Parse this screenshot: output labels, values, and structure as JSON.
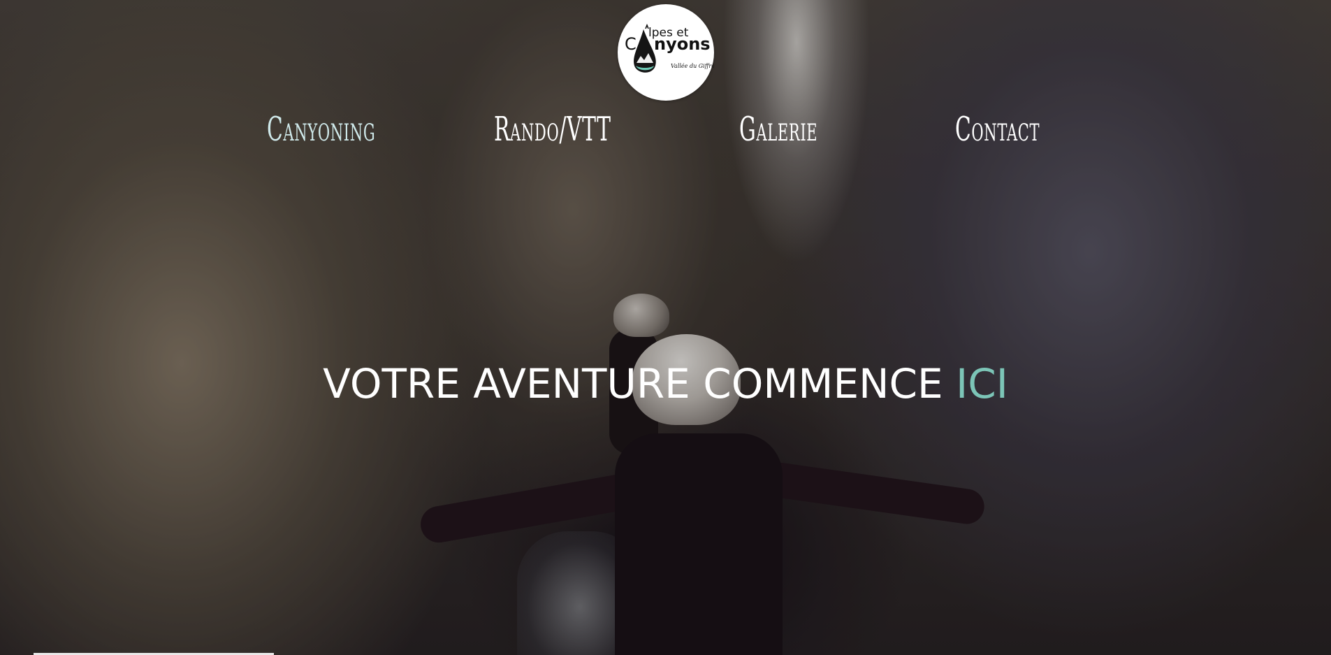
{
  "logo": {
    "text_line1": "lpes et",
    "text_line2_left": "C",
    "text_line2_right": "nyons",
    "tagline": "Vallée du Giffre",
    "icon": "mountain-drop-logo"
  },
  "nav": {
    "items": [
      {
        "label": "Canyoning",
        "active": true
      },
      {
        "label": "Rando/VTT",
        "active": false
      },
      {
        "label": "Galerie",
        "active": false
      },
      {
        "label": "Contact",
        "active": false
      }
    ]
  },
  "hero": {
    "headline_main": "VOTRE AVENTURE COMMENCE",
    "headline_accent": "ICI",
    "accent_color": "#7cc5b7"
  }
}
